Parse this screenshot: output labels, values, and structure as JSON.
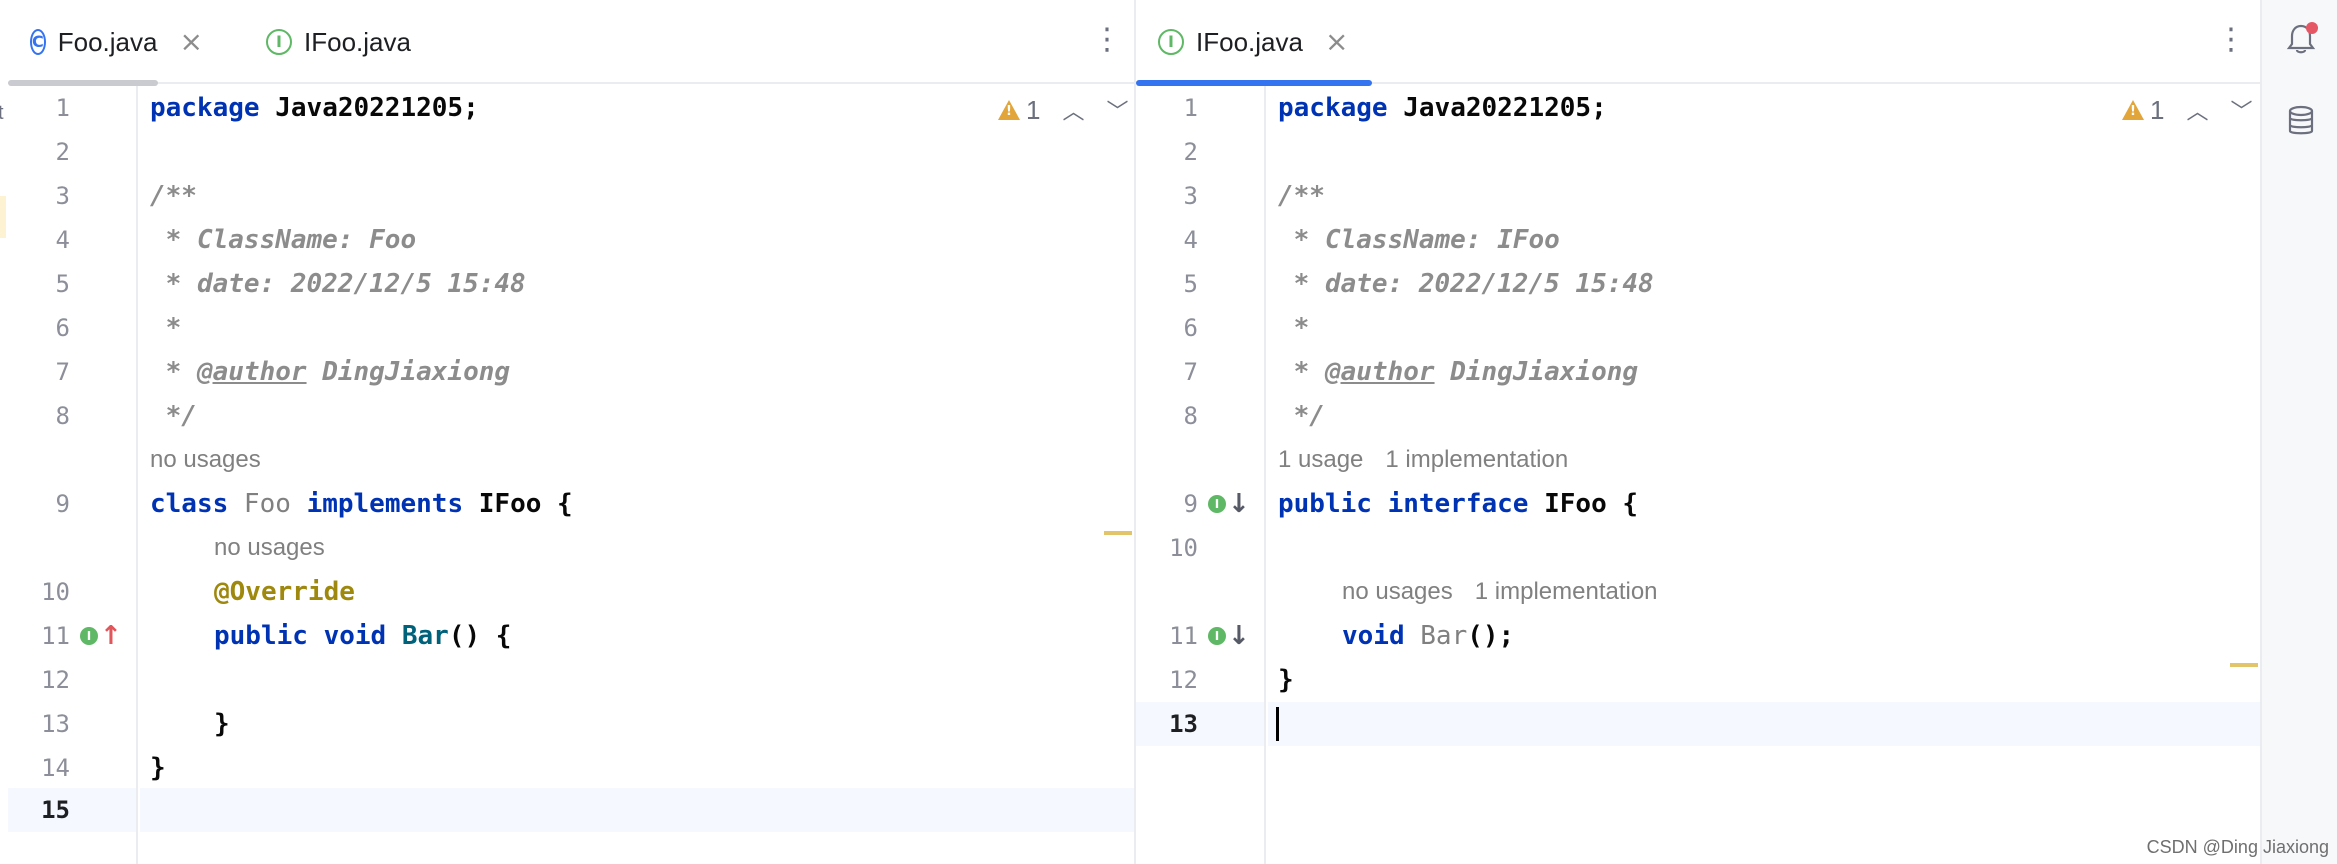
{
  "left_pane": {
    "tabs": [
      {
        "label": "Foo.java",
        "icon": "class-icon",
        "icon_glyph": "C",
        "close": "×"
      },
      {
        "label": "IFoo.java",
        "icon": "interface-icon",
        "icon_glyph": "I"
      }
    ],
    "menu": "⋮",
    "inspection": {
      "count": "1",
      "up": "︿",
      "down": "﹀"
    },
    "line_numbers": [
      "1",
      "2",
      "3",
      "4",
      "5",
      "6",
      "7",
      "8",
      "9",
      "10",
      "11",
      "12",
      "13",
      "14",
      "15"
    ],
    "code": {
      "l1_kw": "package",
      "l1_rest": " Java20221205;",
      "l3": "/**",
      "l4": " * ClassName: Foo",
      "l5": " * date: 2022/12/5 15:48",
      "l6": " *",
      "l7_pre": " * ",
      "l7_tag": "@author",
      "l7_post": " DingJiaxiong",
      "l8": " */",
      "hint_class": "no usages",
      "l9_kw1": "class",
      "l9_name": " Foo ",
      "l9_kw2": "implements",
      "l9_rest": " IFoo {",
      "hint_method": "no usages",
      "l10_anno": "@Override",
      "l11_kw": "public void",
      "l11_method": " Bar",
      "l11_rest": "() {",
      "l13": "}",
      "l14": "}"
    },
    "gutter_marks": {
      "impl": "I",
      "up_arrow": "↑"
    }
  },
  "right_pane": {
    "tabs": [
      {
        "label": "IFoo.java",
        "icon": "interface-icon",
        "icon_glyph": "I",
        "close": "×"
      }
    ],
    "menu": "⋮",
    "inspection": {
      "count": "1",
      "up": "︿",
      "down": "﹀"
    },
    "line_numbers": [
      "1",
      "2",
      "3",
      "4",
      "5",
      "6",
      "7",
      "8",
      "9",
      "10",
      "11",
      "12",
      "13"
    ],
    "code": {
      "l1_kw": "package",
      "l1_rest": " Java20221205;",
      "l3": "/**",
      "l4": " * ClassName: IFoo",
      "l5": " * date: 2022/12/5 15:48",
      "l6": " *",
      "l7_pre": " * ",
      "l7_tag": "@author",
      "l7_post": " DingJiaxiong",
      "l8": " */",
      "hint_iface_usage": "1 usage",
      "hint_iface_impl": "1 implementation",
      "l9_kw": "public interface",
      "l9_rest": " IFoo {",
      "hint_method_usage": "no usages",
      "hint_method_impl": "1 implementation",
      "l11_kw": "void",
      "l11_method": " Bar",
      "l11_rest": "();",
      "l12": "}"
    },
    "gutter_marks": {
      "impl": "I",
      "down_arrow": "↓"
    }
  },
  "right_toolbar": {
    "notifications_icon": "bell-icon",
    "database_icon": "database-icon"
  },
  "left_edge_stub": "t",
  "watermark": "CSDN @Ding Jiaxiong"
}
